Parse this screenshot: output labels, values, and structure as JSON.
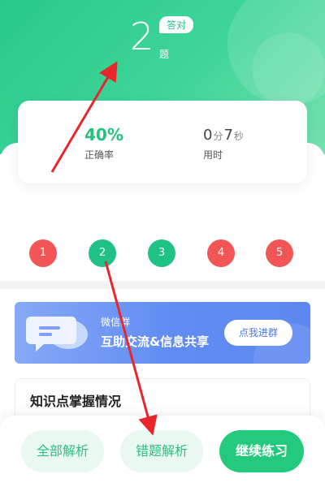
{
  "result": {
    "score": "2",
    "score_unit": "题",
    "badge": "答对"
  },
  "stats": {
    "accuracy_value": "40%",
    "accuracy_label": "正确率",
    "time_min": "0",
    "time_min_unit": "分",
    "time_sec": "7",
    "time_sec_unit": "秒",
    "time_label": "用时"
  },
  "questions": [
    {
      "num": "1",
      "status": "wrong",
      "color": "#f25555"
    },
    {
      "num": "2",
      "status": "correct",
      "color": "#20c184"
    },
    {
      "num": "3",
      "status": "correct",
      "color": "#20c184"
    },
    {
      "num": "4",
      "status": "wrong",
      "color": "#f25555"
    },
    {
      "num": "5",
      "status": "wrong",
      "color": "#f25555"
    }
  ],
  "banner": {
    "title": "微信群",
    "subtitle": "互助交流&信息共享",
    "button": "点我进群"
  },
  "knowledge": {
    "title": "知识点掌握情况"
  },
  "actions": {
    "all_analysis": "全部解析",
    "wrong_analysis": "错题解析",
    "continue": "继续练习"
  },
  "colors": {
    "brand_green": "#23c97d",
    "wrong_red": "#f25555",
    "banner_blue": "#5f8bf2",
    "annotation_arrow": "#e8262b"
  }
}
